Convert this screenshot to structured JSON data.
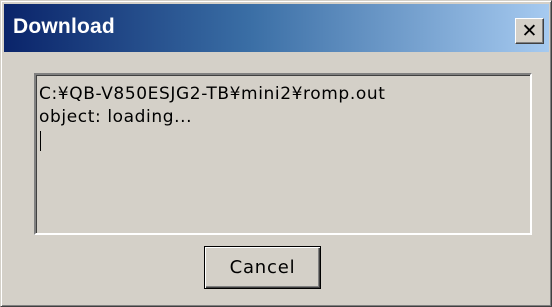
{
  "window": {
    "title": "Download",
    "close_glyph": "✕",
    "close_icon": "close-icon"
  },
  "log": {
    "lines": [
      "C:¥QB-V850ESJG2-TB¥mini2¥romp.out",
      "object: loading..."
    ]
  },
  "buttons": {
    "cancel_label": "Cancel"
  },
  "colors": {
    "titlebar_start": "#0a246a",
    "titlebar_end": "#a6caf0",
    "face": "#d4d0c8"
  }
}
